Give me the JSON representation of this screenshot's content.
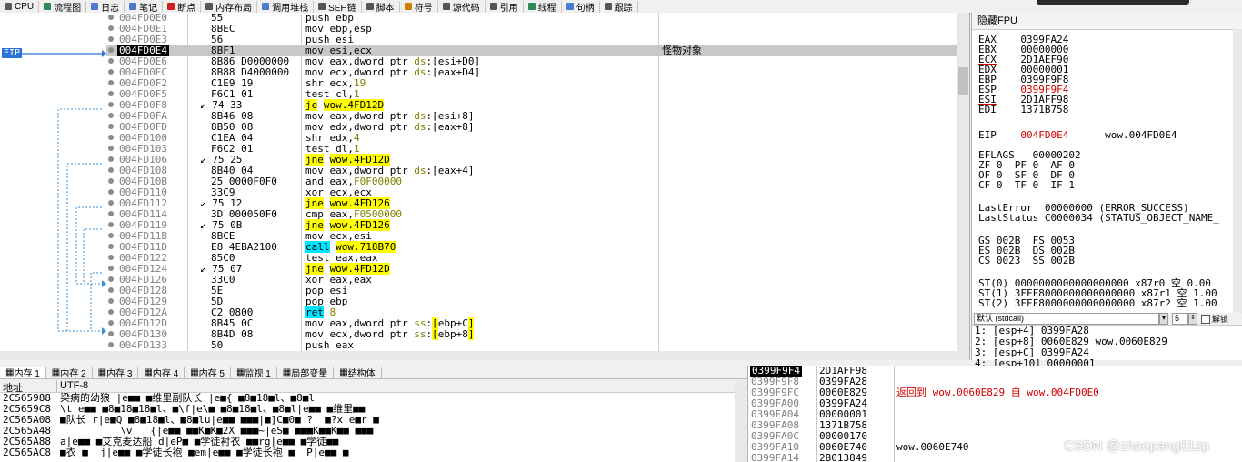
{
  "toolbar": {
    "tabs": [
      {
        "label": "CPU",
        "icon": "cpu-icon",
        "color": "#5a5a5a"
      },
      {
        "label": "流程图",
        "icon": "graph-icon",
        "color": "#2e8b57"
      },
      {
        "label": "日志",
        "icon": "log-icon",
        "color": "#4a7bd0"
      },
      {
        "label": "笔记",
        "icon": "notes-icon",
        "color": "#4a7bd0"
      },
      {
        "label": "断点",
        "icon": "breakpoint-icon",
        "color": "#d02020"
      },
      {
        "label": "内存布局",
        "icon": "memory-map-icon",
        "color": "#555555"
      },
      {
        "label": "调用堆栈",
        "icon": "callstack-icon",
        "color": "#4a7bd0"
      },
      {
        "label": "SEH链",
        "icon": "seh-icon",
        "color": "#555555"
      },
      {
        "label": "脚本",
        "icon": "script-icon",
        "color": "#555555"
      },
      {
        "label": "符号",
        "icon": "symbol-icon",
        "color": "#d08000"
      },
      {
        "label": "源代码",
        "icon": "source-icon",
        "color": "#555555"
      },
      {
        "label": "引用",
        "icon": "references-icon",
        "color": "#555555"
      },
      {
        "label": "线程",
        "icon": "threads-icon",
        "color": "#2e8b57"
      },
      {
        "label": "句柄",
        "icon": "handles-icon",
        "color": "#4a7bd0"
      },
      {
        "label": "跟踪",
        "icon": "trace-icon",
        "color": "#555555"
      }
    ]
  },
  "disasm": {
    "eip_label": "EIP",
    "rows": [
      {
        "addr": "004FD0E0",
        "bytes": "55",
        "asm": [
          [
            "t",
            "push ebp"
          ]
        ],
        "cmt": ""
      },
      {
        "addr": "004FD0E1",
        "bytes": "8BEC",
        "asm": [
          [
            "t",
            "mov ebp,esp"
          ]
        ],
        "cmt": ""
      },
      {
        "addr": "004FD0E3",
        "bytes": "56",
        "asm": [
          [
            "t",
            "push esi"
          ]
        ],
        "cmt": ""
      },
      {
        "addr": "004FD0E4",
        "bytes": "8BF1",
        "asm": [
          [
            "t",
            "mov esi,ecx"
          ]
        ],
        "cmt": "怪物对象",
        "cur": true
      },
      {
        "addr": "004FD0E6",
        "bytes": "8B86 D0000000",
        "asm": [
          [
            "t",
            "mov eax,dword ptr "
          ],
          [
            "s",
            "ds"
          ],
          [
            "t",
            ":["
          ],
          [
            "t",
            "esi+D0"
          ],
          [
            "t",
            "]"
          ]
        ],
        "cmt": ""
      },
      {
        "addr": "004FD0EC",
        "bytes": "8B88 D4000000",
        "asm": [
          [
            "t",
            "mov ecx,dword ptr "
          ],
          [
            "s",
            "ds"
          ],
          [
            "t",
            ":["
          ],
          [
            "t",
            "eax+D4"
          ],
          [
            "t",
            "]"
          ]
        ],
        "cmt": ""
      },
      {
        "addr": "004FD0F2",
        "bytes": "C1E9 19",
        "asm": [
          [
            "t",
            "shr ecx,"
          ],
          [
            "n",
            "19"
          ]
        ],
        "cmt": ""
      },
      {
        "addr": "004FD0F5",
        "bytes": "F6C1 01",
        "asm": [
          [
            "t",
            "test cl,"
          ],
          [
            "n",
            "1"
          ]
        ],
        "cmt": ""
      },
      {
        "addr": "004FD0F8",
        "bytes": "74 33",
        "arrow": true,
        "asm": [
          [
            "j",
            "je"
          ],
          [
            "t",
            " "
          ],
          [
            "j",
            "wow.4FD12D"
          ]
        ],
        "cmt": ""
      },
      {
        "addr": "004FD0FA",
        "bytes": "8B46 08",
        "asm": [
          [
            "t",
            "mov eax,dword ptr "
          ],
          [
            "s",
            "ds"
          ],
          [
            "t",
            ":["
          ],
          [
            "t",
            "esi+8"
          ],
          [
            "t",
            "]"
          ]
        ],
        "cmt": ""
      },
      {
        "addr": "004FD0FD",
        "bytes": "8B50 08",
        "asm": [
          [
            "t",
            "mov edx,dword ptr "
          ],
          [
            "s",
            "ds"
          ],
          [
            "t",
            ":["
          ],
          [
            "t",
            "eax+8"
          ],
          [
            "t",
            "]"
          ]
        ],
        "cmt": ""
      },
      {
        "addr": "004FD100",
        "bytes": "C1EA 04",
        "asm": [
          [
            "t",
            "shr edx,"
          ],
          [
            "n",
            "4"
          ]
        ],
        "cmt": ""
      },
      {
        "addr": "004FD103",
        "bytes": "F6C2 01",
        "asm": [
          [
            "t",
            "test dl,"
          ],
          [
            "n",
            "1"
          ]
        ],
        "cmt": ""
      },
      {
        "addr": "004FD106",
        "bytes": "75 25",
        "arrow": true,
        "asm": [
          [
            "j",
            "jne"
          ],
          [
            "t",
            " "
          ],
          [
            "j",
            "wow.4FD12D"
          ]
        ],
        "cmt": ""
      },
      {
        "addr": "004FD108",
        "bytes": "8B40 04",
        "asm": [
          [
            "t",
            "mov eax,dword ptr "
          ],
          [
            "s",
            "ds"
          ],
          [
            "t",
            ":["
          ],
          [
            "t",
            "eax+4"
          ],
          [
            "t",
            "]"
          ]
        ],
        "cmt": ""
      },
      {
        "addr": "004FD10B",
        "bytes": "25 0000F0F0",
        "asm": [
          [
            "t",
            "and eax,"
          ],
          [
            "n",
            "F0F00000"
          ]
        ],
        "cmt": ""
      },
      {
        "addr": "004FD110",
        "bytes": "33C9",
        "asm": [
          [
            "t",
            "xor ecx,ecx"
          ]
        ],
        "cmt": ""
      },
      {
        "addr": "004FD112",
        "bytes": "75 12",
        "arrow": true,
        "asm": [
          [
            "j",
            "jne"
          ],
          [
            "t",
            " "
          ],
          [
            "j",
            "wow.4FD126"
          ]
        ],
        "cmt": ""
      },
      {
        "addr": "004FD114",
        "bytes": "3D 000050F0",
        "asm": [
          [
            "t",
            "cmp eax,"
          ],
          [
            "n",
            "F0500000"
          ]
        ],
        "cmt": ""
      },
      {
        "addr": "004FD119",
        "bytes": "75 0B",
        "arrow": true,
        "asm": [
          [
            "j",
            "jne"
          ],
          [
            "t",
            " "
          ],
          [
            "j",
            "wow.4FD126"
          ]
        ],
        "cmt": ""
      },
      {
        "addr": "004FD11B",
        "bytes": "8BCE",
        "asm": [
          [
            "t",
            "mov ecx,esi"
          ]
        ],
        "cmt": ""
      },
      {
        "addr": "004FD11D",
        "bytes": "E8 4EBA2100",
        "asm": [
          [
            "c",
            "call"
          ],
          [
            "t",
            " "
          ],
          [
            "j",
            "wow.718B70"
          ]
        ],
        "cmt": ""
      },
      {
        "addr": "004FD122",
        "bytes": "85C0",
        "asm": [
          [
            "t",
            "test eax,eax"
          ]
        ],
        "cmt": ""
      },
      {
        "addr": "004FD124",
        "bytes": "75 07",
        "arrow": true,
        "asm": [
          [
            "j",
            "jne"
          ],
          [
            "t",
            " "
          ],
          [
            "j",
            "wow.4FD12D"
          ]
        ],
        "cmt": ""
      },
      {
        "addr": "004FD126",
        "bytes": "33C0",
        "asm": [
          [
            "t",
            "xor eax,eax"
          ]
        ],
        "cmt": ""
      },
      {
        "addr": "004FD128",
        "bytes": "5E",
        "asm": [
          [
            "t",
            "pop esi"
          ]
        ],
        "cmt": ""
      },
      {
        "addr": "004FD129",
        "bytes": "5D",
        "asm": [
          [
            "t",
            "pop ebp"
          ]
        ],
        "cmt": ""
      },
      {
        "addr": "004FD12A",
        "bytes": "C2 0800",
        "asm": [
          [
            "c",
            "ret"
          ],
          [
            "t",
            " "
          ],
          [
            "n",
            "8"
          ]
        ],
        "cmt": ""
      },
      {
        "addr": "004FD12D",
        "bytes": "8B45 0C",
        "asm": [
          [
            "t",
            "mov eax,dword ptr "
          ],
          [
            "s",
            "ss"
          ],
          [
            "t",
            ":"
          ],
          [
            "b",
            "["
          ],
          [
            "t",
            "ebp+C"
          ],
          [
            "b",
            "]"
          ]
        ],
        "cmt": ""
      },
      {
        "addr": "004FD130",
        "bytes": "8B4D 08",
        "asm": [
          [
            "t",
            "mov ecx,dword ptr "
          ],
          [
            "s",
            "ss"
          ],
          [
            "t",
            ":"
          ],
          [
            "b",
            "["
          ],
          [
            "t",
            "ebp+8"
          ],
          [
            "b",
            "]"
          ]
        ],
        "cmt": ""
      },
      {
        "addr": "004FD133",
        "bytes": "50",
        "asm": [
          [
            "t",
            "push eax"
          ]
        ],
        "cmt": ""
      }
    ]
  },
  "regs": {
    "title": "隐藏FPU",
    "lines": [
      [
        [
          "EAX",
          "0399FA24"
        ]
      ],
      [
        [
          "EBX",
          "00000000"
        ]
      ],
      [
        [
          "ECX",
          "2D1AEF90"
        ]
      ],
      [
        [
          "EDX",
          "00000001"
        ]
      ],
      [
        [
          "EBP",
          "0399F9F8"
        ]
      ],
      [
        [
          "ESP",
          "0399F9F4"
        ]
      ],
      [
        [
          "ESI",
          "2D1AFF98"
        ]
      ],
      [
        [
          "EDI",
          "1371B758"
        ]
      ]
    ],
    "eip": "EIP    004FD0E4      wow.004FD0E4",
    "flags": [
      "EFLAGS   00000202",
      "ZF 0  PF 0  AF 0",
      "OF 0  SF 0  DF 0",
      "CF 0  TF 0  IF 1"
    ],
    "last": [
      "LastError  00000000 (ERROR_SUCCESS)",
      "LastStatus C0000034 (STATUS_OBJECT_NAME_"
    ],
    "segs": [
      "GS 002B  FS 0053",
      "ES 002B  DS 002B",
      "CS 0023  SS 002B"
    ],
    "st": [
      "ST(0) 0000000000000000000 x87r0 空 0.00",
      "ST(1) 3FFF8000000000000000 x87r1 空 1.00",
      "ST(2) 3FFF8000000000000000 x87r2 空 1.00"
    ]
  },
  "stackargs": {
    "convention": "默认 (stdcall)",
    "count": "5",
    "unlock_label": "解锁",
    "lines": [
      "1: [esp+4] 0399FA28",
      "2: [esp+8] 0060E829 wow.0060E829",
      "3: [esp+C] 0399FA24",
      "4: [esp+10] 00000001"
    ]
  },
  "bottom_tabs": [
    "内存 1",
    "内存 2",
    "内存 3",
    "内存 4",
    "内存 5",
    "监视 1",
    "局部变量",
    "结构体"
  ],
  "dump": {
    "col_addr": "地址",
    "col_text": "UTF-8",
    "rows": [
      {
        "a": "2C565988",
        "t": "梁病的幼狼 |e■■ ■维里副队长 |e■{ ■8■18■l、■8■l"
      },
      {
        "a": "2C5659C8",
        "t": "\\t|e■■ ■8■18■18■l、■\\f|e\\■ ■8■18■l、■8■l|e■■ ■维里■■"
      },
      {
        "a": "2C565A08",
        "t": "■队长 r|e■Q ■8■18■l、■8■lu|e■■ ■■■|■]C■0■ ?  ■?x|e■r ■"
      },
      {
        "a": "2C565A48",
        "t": "          \\v   {|e■■ ■■K■K■2X ■■■~|eS■ ■■■K■■K■■ ■■■"
      },
      {
        "a": "2C565A88",
        "t": "a|e■■ ■艾克麦达船 d|eP■ ■学徒衬衣 ■■rg|e■■ ■学徒■■"
      },
      {
        "a": "2C565AC8",
        "t": "■衣 ■  j|e■■ ■学徒长袍 ■em|e■■ ■学徒长袍 ■  P|e■■ ■"
      }
    ]
  },
  "stack": {
    "rows": [
      {
        "a": "0399F9F4",
        "v": "2D1AFF98",
        "c": "",
        "cur": true
      },
      {
        "a": "0399F9F8",
        "v": "0399FA28",
        "c": ""
      },
      {
        "a": "0399F9FC",
        "v": "0060E829",
        "c": "返回到 wow.0060E829 自 wow.004FD0E0",
        "red": true
      },
      {
        "a": "0399FA00",
        "v": "0399FA24",
        "c": ""
      },
      {
        "a": "0399FA04",
        "v": "00000001",
        "c": ""
      },
      {
        "a": "0399FA08",
        "v": "1371B758",
        "c": ""
      },
      {
        "a": "0399FA0C",
        "v": "00000170",
        "c": ""
      },
      {
        "a": "0399FA10",
        "v": "0060E740",
        "c": "wow.0060E740"
      },
      {
        "a": "0399FA14",
        "v": "2B013849",
        "c": ""
      }
    ]
  },
  "watermark": "CSDN @zhaopeng01zp"
}
